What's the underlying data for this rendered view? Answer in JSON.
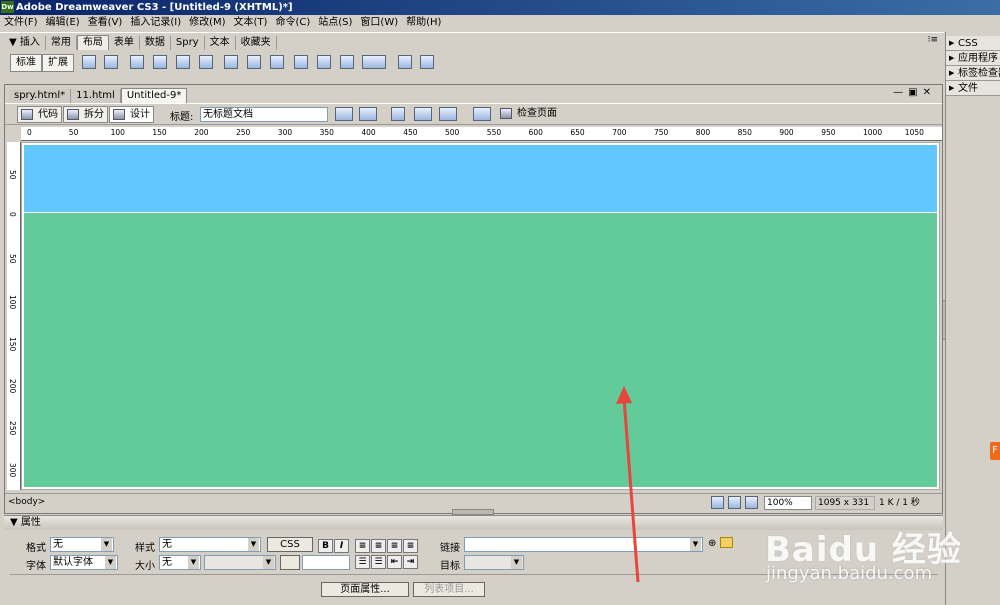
{
  "app": {
    "title": "Adobe Dreamweaver CS3 - [Untitled-9 (XHTML)*]",
    "logo": "Dw"
  },
  "menu": [
    "文件(F)",
    "编辑(E)",
    "查看(V)",
    "插入记录(I)",
    "修改(M)",
    "文本(T)",
    "命令(C)",
    "站点(S)",
    "窗口(W)",
    "帮助(H)"
  ],
  "insert_bar": {
    "header": "▼ 插入",
    "tabs": [
      "常用",
      "布局",
      "表单",
      "数据",
      "Spry",
      "文本",
      "收藏夹"
    ],
    "active_tab": "布局",
    "mode_buttons": [
      "标准",
      "扩展"
    ]
  },
  "right_panels": [
    "CSS",
    "应用程序",
    "标签检查器",
    "文件"
  ],
  "doc_tabs": [
    "spry.html*",
    "11.html",
    "Untitled-9*"
  ],
  "doc_toolbar": {
    "code": "代码",
    "split": "拆分",
    "design": "设计",
    "title_label": "标题:",
    "title_value": "无标题文档",
    "check_page": "检查页面"
  },
  "ruler": {
    "top": [
      "0",
      "50",
      "100",
      "150",
      "200",
      "250",
      "300",
      "350",
      "400",
      "450",
      "500",
      "550",
      "600",
      "650",
      "700",
      "750",
      "800",
      "850",
      "900",
      "950",
      "1000",
      "1050"
    ],
    "left": [
      "50",
      "0",
      "50",
      "100",
      "150",
      "200",
      "250",
      "300"
    ]
  },
  "canvas": {
    "top_color": "#61c7fe",
    "bottom_color": "#63cb9a"
  },
  "status": {
    "tag": "<body>",
    "zoom": "100%",
    "size": "1095 x 331",
    "file": "1 K / 1 秒"
  },
  "properties": {
    "header": "▼ 属性",
    "format_label": "格式",
    "format_value": "无",
    "style_label": "样式",
    "style_value": "无",
    "css_button": "CSS",
    "bold": "B",
    "italic": "I",
    "link_label": "链接",
    "font_label": "字体",
    "font_value": "默认字体",
    "size_label": "大小",
    "size_value": "无",
    "target_label": "目标",
    "page_props_button": "页面属性...",
    "list_item_button": "列表项目..."
  },
  "watermark": {
    "main": "Baidu 经验",
    "sub": "jingyan.baidu.com"
  },
  "side_badge": "F"
}
